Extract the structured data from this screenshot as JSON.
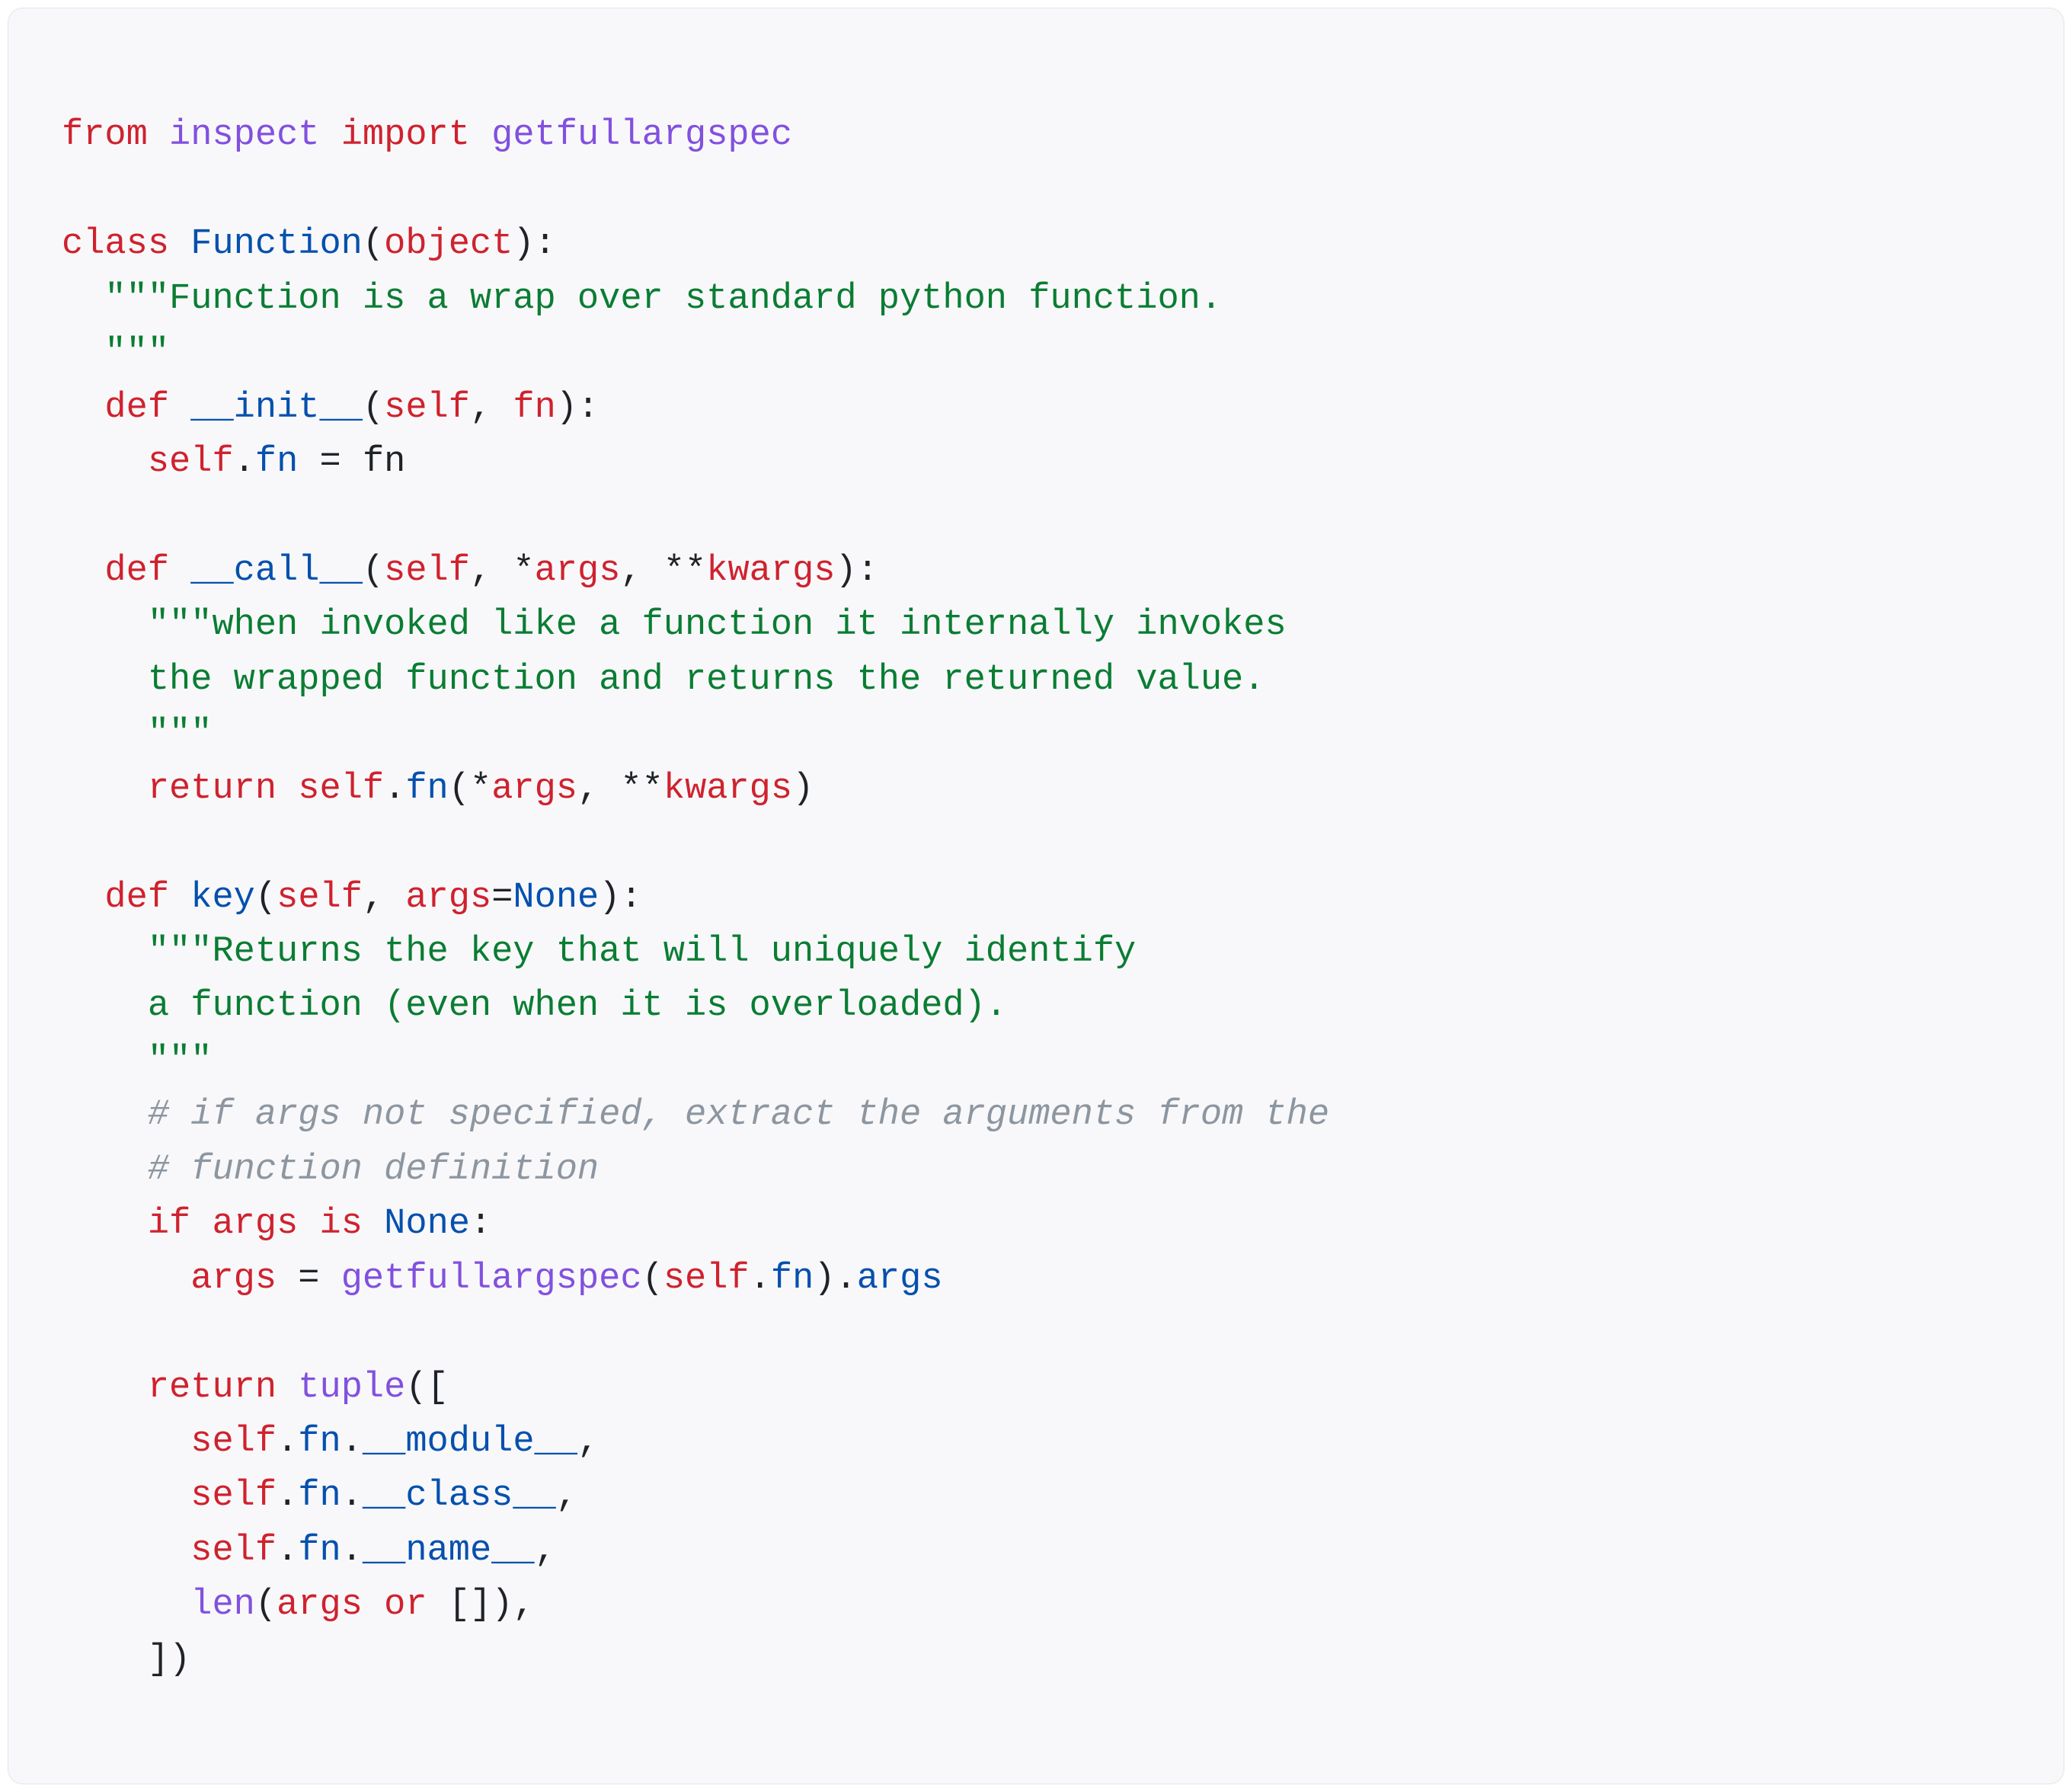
{
  "code": {
    "l1": {
      "from": "from",
      "sp1": " ",
      "mod": "inspect",
      "sp2": " ",
      "import": "import",
      "sp3": " ",
      "fn": "getfullargspec"
    },
    "l2": "",
    "l3": {
      "class": "class",
      "sp1": " ",
      "name": "Function",
      "op": "(",
      "base": "object",
      "cp": "):"
    },
    "l4": {
      "ind": "  ",
      "doc": "\"\"\"Function is a wrap over standard python function."
    },
    "l5": {
      "ind": "  ",
      "doc": "\"\"\""
    },
    "l6": {
      "ind": "  ",
      "def": "def",
      "sp1": " ",
      "name": "__init__",
      "op": "(",
      "p1": "self",
      "c1": ", ",
      "p2": "fn",
      "cp": "):"
    },
    "l7": {
      "ind": "    ",
      "self": "self",
      "dot": ".",
      "attr": "fn",
      "sp1": " ",
      "eq": "=",
      "sp2": " ",
      "rhs": "fn"
    },
    "l8": "",
    "l9": {
      "ind": "  ",
      "def": "def",
      "sp1": " ",
      "name": "__call__",
      "op": "(",
      "p1": "self",
      "c1": ", ",
      "star": "*",
      "p2": "args",
      "c2": ", ",
      "star2": "**",
      "p3": "kwargs",
      "cp": "):"
    },
    "l10": {
      "ind": "    ",
      "doc": "\"\"\"when invoked like a function it internally invokes"
    },
    "l11": {
      "ind": "    ",
      "doc": "the wrapped function and returns the returned value."
    },
    "l12": {
      "ind": "    ",
      "doc": "\"\"\""
    },
    "l13": {
      "ind": "    ",
      "return": "return",
      "sp1": " ",
      "self": "self",
      "dot": ".",
      "fn": "fn",
      "op": "(",
      "star": "*",
      "args": "args",
      "c1": ", ",
      "star2": "**",
      "kwargs": "kwargs",
      "cp": ")"
    },
    "l14": "",
    "l15": {
      "ind": "  ",
      "def": "def",
      "sp1": " ",
      "name": "key",
      "op": "(",
      "p1": "self",
      "c1": ", ",
      "p2": "args",
      "eq": "=",
      "none": "None",
      "cp": "):"
    },
    "l16": {
      "ind": "    ",
      "doc": "\"\"\"Returns the key that will uniquely identify"
    },
    "l17": {
      "ind": "    ",
      "doc": "a function (even when it is overloaded)."
    },
    "l18": {
      "ind": "    ",
      "doc": "\"\"\""
    },
    "l19": {
      "ind": "    ",
      "cmt": "# if args not specified, extract the arguments from the"
    },
    "l20": {
      "ind": "    ",
      "cmt": "# function definition"
    },
    "l21": {
      "ind": "    ",
      "if": "if",
      "sp1": " ",
      "args": "args",
      "sp2": " ",
      "is": "is",
      "sp3": " ",
      "none": "None",
      "colon": ":"
    },
    "l22": {
      "ind": "      ",
      "args": "args",
      "sp1": " ",
      "eq": "=",
      "sp2": " ",
      "call": "getfullargspec",
      "op": "(",
      "self": "self",
      "dot": ".",
      "fn": "fn",
      "cp": ")",
      "dot2": ".",
      "attr": "args"
    },
    "l23": "",
    "l24": {
      "ind": "    ",
      "return": "return",
      "sp1": " ",
      "tuple": "tuple",
      "op": "(["
    },
    "l25": {
      "ind": "      ",
      "self": "self",
      "dot": ".",
      "fn": "fn",
      "dot2": ".",
      "attr": "__module__",
      "c": ","
    },
    "l26": {
      "ind": "      ",
      "self": "self",
      "dot": ".",
      "fn": "fn",
      "dot2": ".",
      "attr": "__class__",
      "c": ","
    },
    "l27": {
      "ind": "      ",
      "self": "self",
      "dot": ".",
      "fn": "fn",
      "dot2": ".",
      "attr": "__name__",
      "c": ","
    },
    "l28": {
      "ind": "      ",
      "len": "len",
      "op": "(",
      "args": "args",
      "sp1": " ",
      "or": "or",
      "sp2": " ",
      "list": "[]",
      "cp": ")",
      "c": ","
    },
    "l29": {
      "ind": "    ",
      "close": "])"
    }
  }
}
